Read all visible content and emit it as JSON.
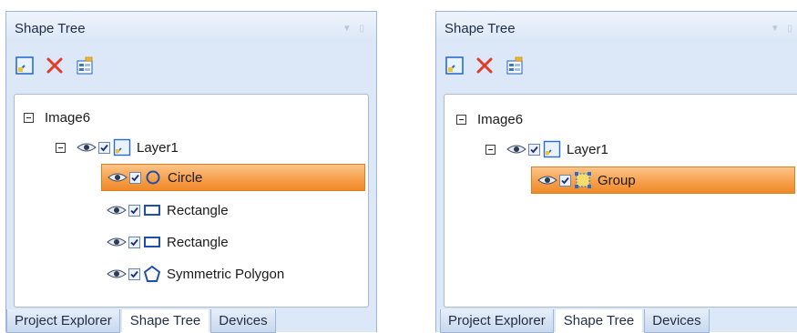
{
  "left_panel": {
    "title": "Shape Tree",
    "toolbar": {
      "add_icon": "add-layer-icon",
      "delete_icon": "delete-x-icon",
      "properties_icon": "properties-icon"
    },
    "tree": {
      "root": "Image6",
      "layer": "Layer1",
      "shapes": [
        "Circle",
        "Rectangle",
        "Rectangle",
        "Symmetric Polygon"
      ],
      "selected": "Circle"
    },
    "tabs": [
      "Project Explorer",
      "Shape Tree",
      "Devices"
    ],
    "active_tab": "Shape Tree"
  },
  "right_panel": {
    "title": "Shape Tree",
    "tree": {
      "root": "Image6",
      "layer": "Layer1",
      "shapes": [
        "Group"
      ],
      "selected": "Group"
    },
    "tabs": [
      "Project Explorer",
      "Shape Tree",
      "Devices"
    ],
    "active_tab": "Shape Tree"
  },
  "colors": {
    "selection": "#f7a04c",
    "panel_bg": "#dce8f7",
    "icon_blue": "#2a6bd1",
    "delete_red": "#e23b2a"
  }
}
